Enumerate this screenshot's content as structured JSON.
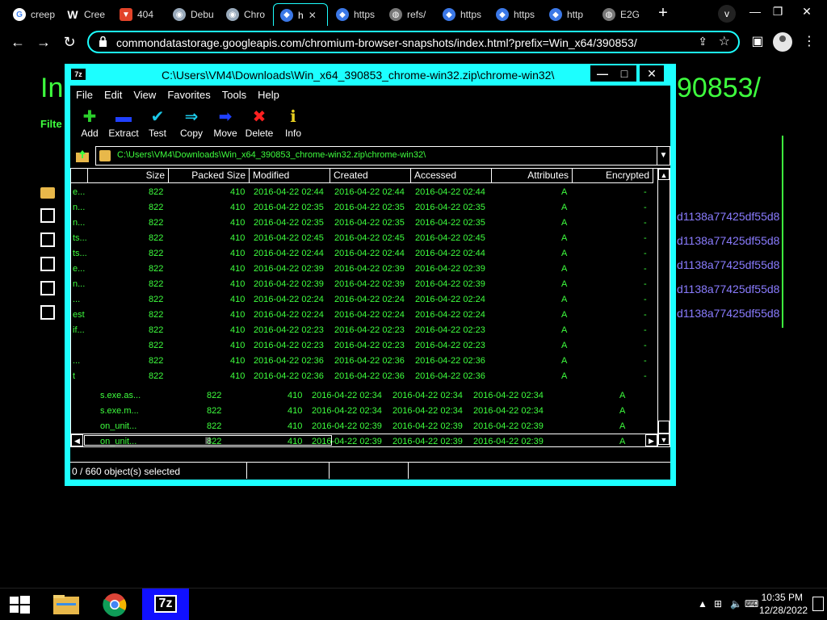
{
  "browser": {
    "tabs": [
      {
        "title": "creep",
        "icon": "google-icon"
      },
      {
        "title": "Cree",
        "icon": "wikipedia-icon"
      },
      {
        "title": "404",
        "icon": "gitlab-icon"
      },
      {
        "title": "Debu",
        "icon": "chrome-icon"
      },
      {
        "title": "Chro",
        "icon": "chrome-icon"
      },
      {
        "title": "h",
        "icon": "hexagon-icon",
        "active": true
      },
      {
        "title": "https",
        "icon": "hexagon-icon"
      },
      {
        "title": "refs/",
        "icon": "globe-icon"
      },
      {
        "title": "https",
        "icon": "hexagon-icon"
      },
      {
        "title": "https",
        "icon": "hexagon-icon"
      },
      {
        "title": "http",
        "icon": "hexagon-icon"
      },
      {
        "title": "E2G",
        "icon": "globe-icon"
      }
    ],
    "new_tab": "+",
    "tab_search": "v",
    "window_min": "—",
    "window_max": "❐",
    "window_close": "✕",
    "url": "commondatastorage.googleapis.com/chromium-browser-snapshots/index.html?prefix=Win_x64/390853/"
  },
  "page": {
    "heading_start": "In",
    "heading_end": "90853/",
    "filter_label": "Filte",
    "hashes": [
      "d1138a77425df55d8",
      "d1138a77425df55d8",
      "d1138a77425df55d8",
      "d1138a77425df55d8",
      "d1138a77425df55d8"
    ]
  },
  "zip": {
    "title": "C:\\Users\\VM4\\Downloads\\Win_x64_390853_chrome-win32.zip\\chrome-win32\\",
    "logo": "7z",
    "menu": [
      "File",
      "Edit",
      "View",
      "Favorites",
      "Tools",
      "Help"
    ],
    "tools": [
      {
        "label": "Add",
        "icon": "plus-icon",
        "glyph": "✚",
        "color": "#2bd02b"
      },
      {
        "label": "Extract",
        "icon": "minus-icon",
        "glyph": "▬",
        "color": "#2040ff"
      },
      {
        "label": "Test",
        "icon": "check-icon",
        "glyph": "✔",
        "color": "#1cc8e8"
      },
      {
        "label": "Copy",
        "icon": "copy-arrow-icon",
        "glyph": "⇒",
        "color": "#1cc8e8"
      },
      {
        "label": "Move",
        "icon": "move-arrow-icon",
        "glyph": "➡",
        "color": "#2040ff"
      },
      {
        "label": "Delete",
        "icon": "delete-x-icon",
        "glyph": "✖",
        "color": "#ff2020"
      },
      {
        "label": "Info",
        "icon": "info-icon",
        "glyph": "ℹ",
        "color": "#e8d020"
      }
    ],
    "path": "C:\\Users\\VM4\\Downloads\\Win_x64_390853_chrome-win32.zip\\chrome-win32\\",
    "columns": [
      "Size",
      "Packed Size",
      "Modified",
      "Created",
      "Accessed",
      "Attributes",
      "Encrypted"
    ],
    "rows": [
      {
        "name": "e...",
        "size": "822",
        "packed": "410",
        "modified": "2016-04-22 02:44",
        "created": "2016-04-22 02:44",
        "accessed": "2016-04-22 02:44",
        "attr": "A",
        "enc": "-"
      },
      {
        "name": "n...",
        "size": "822",
        "packed": "410",
        "modified": "2016-04-22 02:35",
        "created": "2016-04-22 02:35",
        "accessed": "2016-04-22 02:35",
        "attr": "A",
        "enc": "-"
      },
      {
        "name": "n...",
        "size": "822",
        "packed": "410",
        "modified": "2016-04-22 02:35",
        "created": "2016-04-22 02:35",
        "accessed": "2016-04-22 02:35",
        "attr": "A",
        "enc": "-"
      },
      {
        "name": "ts...",
        "size": "822",
        "packed": "410",
        "modified": "2016-04-22 02:45",
        "created": "2016-04-22 02:45",
        "accessed": "2016-04-22 02:45",
        "attr": "A",
        "enc": "-"
      },
      {
        "name": "ts...",
        "size": "822",
        "packed": "410",
        "modified": "2016-04-22 02:44",
        "created": "2016-04-22 02:44",
        "accessed": "2016-04-22 02:44",
        "attr": "A",
        "enc": "-"
      },
      {
        "name": "e...",
        "size": "822",
        "packed": "410",
        "modified": "2016-04-22 02:39",
        "created": "2016-04-22 02:39",
        "accessed": "2016-04-22 02:39",
        "attr": "A",
        "enc": "-"
      },
      {
        "name": "n...",
        "size": "822",
        "packed": "410",
        "modified": "2016-04-22 02:39",
        "created": "2016-04-22 02:39",
        "accessed": "2016-04-22 02:39",
        "attr": "A",
        "enc": "-"
      },
      {
        "name": "...",
        "size": "822",
        "packed": "410",
        "modified": "2016-04-22 02:24",
        "created": "2016-04-22 02:24",
        "accessed": "2016-04-22 02:24",
        "attr": "A",
        "enc": "-"
      },
      {
        "name": "est",
        "size": "822",
        "packed": "410",
        "modified": "2016-04-22 02:24",
        "created": "2016-04-22 02:24",
        "accessed": "2016-04-22 02:24",
        "attr": "A",
        "enc": "-"
      },
      {
        "name": "if...",
        "size": "822",
        "packed": "410",
        "modified": "2016-04-22 02:23",
        "created": "2016-04-22 02:23",
        "accessed": "2016-04-22 02:23",
        "attr": "A",
        "enc": "-"
      },
      {
        "name": "",
        "size": "822",
        "packed": "410",
        "modified": "2016-04-22 02:23",
        "created": "2016-04-22 02:23",
        "accessed": "2016-04-22 02:23",
        "attr": "A",
        "enc": "-"
      },
      {
        "name": "...",
        "size": "822",
        "packed": "410",
        "modified": "2016-04-22 02:36",
        "created": "2016-04-22 02:36",
        "accessed": "2016-04-22 02:36",
        "attr": "A",
        "enc": "-"
      },
      {
        "name": "t",
        "size": "822",
        "packed": "410",
        "modified": "2016-04-22 02:36",
        "created": "2016-04-22 02:36",
        "accessed": "2016-04-22 02:36",
        "attr": "A",
        "enc": "-"
      }
    ],
    "shifted_rows": [
      {
        "name": "s.exe.as...",
        "size": "822",
        "packed": "410",
        "modified": "2016-04-22 02:34",
        "created": "2016-04-22 02:34",
        "accessed": "2016-04-22 02:34",
        "attr": "A"
      },
      {
        "name": "s.exe.m...",
        "size": "822",
        "packed": "410",
        "modified": "2016-04-22 02:34",
        "created": "2016-04-22 02:34",
        "accessed": "2016-04-22 02:34",
        "attr": "A"
      },
      {
        "name": "on_unit...",
        "size": "822",
        "packed": "410",
        "modified": "2016-04-22 02:39",
        "created": "2016-04-22 02:39",
        "accessed": "2016-04-22 02:39",
        "attr": "A"
      },
      {
        "name": "on_unit...",
        "size": "822",
        "packed": "410",
        "modified": "2016-04-22 02:39",
        "created": "2016-04-22 02:39",
        "accessed": "2016-04-22 02:39",
        "attr": "A"
      }
    ],
    "status": "0 / 660 object(s) selected"
  },
  "taskbar": {
    "time": "10:35 PM",
    "date": "12/28/2022",
    "items": [
      "windows-start-icon",
      "file-explorer-icon",
      "chrome-icon",
      "7zip-icon"
    ],
    "active_label": "7z"
  }
}
